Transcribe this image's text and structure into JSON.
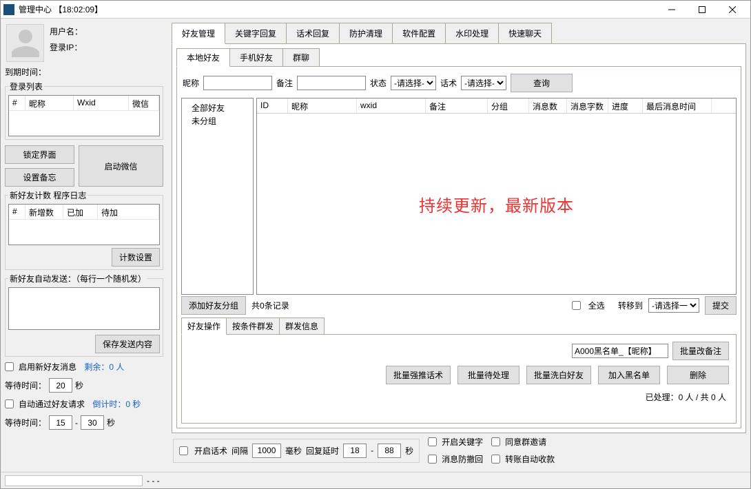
{
  "window": {
    "title": "管理中心 【18:02:09】"
  },
  "user": {
    "username_label": "用户名：",
    "login_ip_label": "登录IP："
  },
  "expire_label": "到期时间：",
  "login_list": {
    "legend": "登录列表",
    "cols": {
      "idx": "#",
      "nickname": "昵称",
      "wxid": "Wxid",
      "wechat": "微信"
    }
  },
  "side_btns": {
    "lock": "锁定界面",
    "memo": "设置备忘",
    "start": "启动微信"
  },
  "counter": {
    "legend": "新好友计数",
    "log_tab": "程序日志",
    "cols": {
      "idx": "#",
      "new": "新增数",
      "added": "已加",
      "pending": "待加"
    },
    "settings_btn": "计数设置"
  },
  "autosend": {
    "legend": "新好友自动发送：（每行一个随机发）",
    "save_btn": "保存发送内容"
  },
  "side_opts": {
    "enable_msg": "启用新好友消息",
    "remain": "剩余：0 人",
    "wait_label": "等待时间：",
    "wait_val": "20",
    "sec": "秒",
    "auto_accept": "自动通过好友请求",
    "countdown": "倒计时：0 秒",
    "wait2_a": "15",
    "wait2_b": "30"
  },
  "main_tabs": [
    "好友管理",
    "关键字回复",
    "话术回复",
    "防护清理",
    "软件配置",
    "水印处理",
    "快速聊天"
  ],
  "sub_tabs": [
    "本地好友",
    "手机好友",
    "群聊"
  ],
  "search": {
    "nickname": "昵称",
    "remark": "备注",
    "status": "状态",
    "please_select": "-请选择-",
    "script": "话术",
    "query": "查询"
  },
  "tree": {
    "all": "全部好友",
    "ungrouped": "未分组"
  },
  "grid_cols": [
    "ID",
    "昵称",
    "wxid",
    "备注",
    "分组",
    "消息数",
    "消息字数",
    "进度",
    "最后消息时间"
  ],
  "grid_widths": [
    45,
    100,
    100,
    90,
    60,
    55,
    60,
    50,
    100
  ],
  "watermark": "持续更新，最新版本",
  "below": {
    "add_group": "添加好友分组",
    "records": "共0条记录",
    "select_all": "全选",
    "move_to": "转移到",
    "please_select_one": "-请选择一",
    "submit": "提交"
  },
  "op_tabs": [
    "好友操作",
    "按条件群发",
    "群发信息"
  ],
  "op_body": {
    "remark_tpl": "A000黑名单_【昵称】",
    "batch_remark": "批量改备注",
    "btns": [
      "批量强推话术",
      "批量待处理",
      "批量洗白好友",
      "加入黑名单",
      "删除"
    ],
    "processed": "已处理：0 人 / 共 0 人"
  },
  "footer": {
    "enable_script": "开启话术",
    "interval": "间隔",
    "interval_val": "1000",
    "ms": "毫秒",
    "reply_delay": "回复延时",
    "delay_a": "18",
    "delay_b": "88",
    "sec": "秒",
    "chk_keyword": "开启关键字",
    "chk_group_invite": "同意群邀请",
    "chk_recall": "消息防撤回",
    "chk_transfer": "转账自动收款"
  },
  "status_dots": "- - -"
}
